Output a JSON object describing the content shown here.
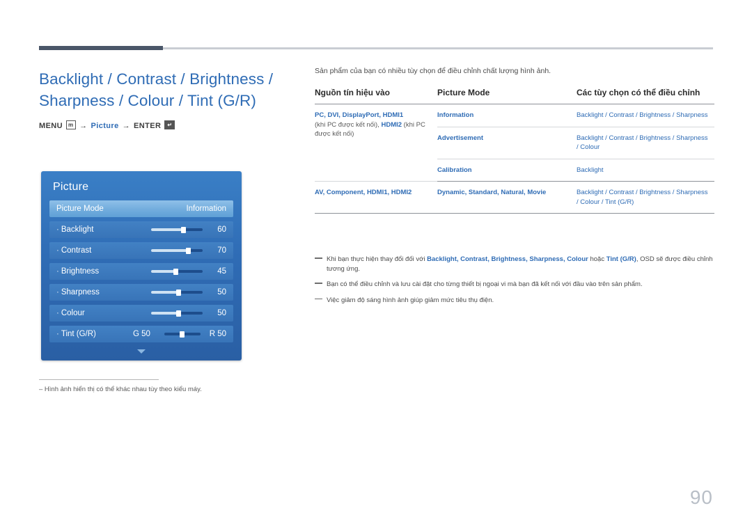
{
  "page": {
    "number": "90"
  },
  "left": {
    "title": "Backlight / Contrast / Brightness / Sharpness / Colour / Tint (G/R)",
    "menu_path": {
      "menu_label": "MENU",
      "menu_icon": "m",
      "arrow1": "→",
      "picture_label": "Picture",
      "arrow2": "→",
      "enter_label": "ENTER",
      "enter_icon": "↵"
    },
    "footnote": "– Hình ảnh hiển thị có thể khác nhau tùy theo kiểu máy."
  },
  "osd": {
    "title": "Picture",
    "rows": [
      {
        "label": "Picture Mode",
        "value": "Information",
        "type": "select",
        "highlight": true
      },
      {
        "label": "Backlight",
        "value": "60",
        "type": "slider",
        "fill": 62
      },
      {
        "label": "Contrast",
        "value": "70",
        "type": "slider",
        "fill": 72
      },
      {
        "label": "Brightness",
        "value": "45",
        "type": "slider",
        "fill": 47
      },
      {
        "label": "Sharpness",
        "value": "50",
        "type": "slider",
        "fill": 52
      },
      {
        "label": "Colour",
        "value": "50",
        "type": "slider",
        "fill": 52
      },
      {
        "label": "Tint (G/R)",
        "value": "R 50",
        "value_left": "G 50",
        "type": "tint"
      }
    ]
  },
  "right": {
    "intro": "Sản phẩm của bạn có nhiều tùy chọn để điều chỉnh chất lượng hình ảnh.",
    "table": {
      "headers": [
        "Nguồn tín hiệu vào",
        "Picture Mode",
        "Các tùy chọn có thể điều chỉnh"
      ],
      "rows": [
        {
          "source_blue": "PC, DVI, DisplayPort, HDMI1",
          "source_rest_1": "(khi PC được kết nối), ",
          "source_blue_2": "HDMI2",
          "source_rest_2": " (khi PC được kết nối)",
          "mode": "Information",
          "options": "Backlight / Contrast / Brightness / Sharpness"
        },
        {
          "mode": "Advertisement",
          "options": "Backlight / Contrast / Brightness / Sharpness / Colour"
        },
        {
          "mode": "Calibration",
          "options": "Backlight"
        },
        {
          "source_blue": "AV, Component, HDMI1, HDMI2",
          "mode": "Dynamic, Standard, Natural, Movie",
          "options": "Backlight / Contrast / Brightness / Sharpness / Colour / Tint (G/R)"
        }
      ]
    },
    "notes": [
      {
        "prefix": "Khi bạn thực hiện thay đổi đối với ",
        "blue": "Backlight, Contrast, Brightness, Sharpness, Colour",
        "mid": " hoặc ",
        "blue2": "Tint (G/R)",
        "suffix": ", OSD sẽ được điều chỉnh tương ứng."
      },
      {
        "text": "Bạn có thể điều chỉnh và lưu cài đặt cho từng thiết bị ngoại vi mà bạn đã kết nối với đầu vào trên sản phẩm."
      },
      {
        "text": "Việc giảm độ sáng hình ảnh giúp giảm mức tiêu thụ điện."
      }
    ]
  },
  "colors": {
    "accent_blue": "#2f6cb5",
    "rule_dark": "#4a5668",
    "page_number": "#b9bfc7"
  }
}
